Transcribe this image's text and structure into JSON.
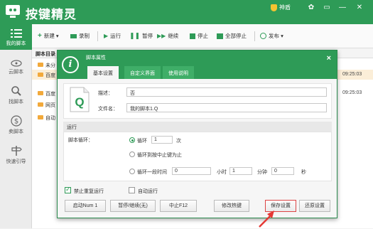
{
  "app": {
    "title": "按键精灵",
    "vip_label": "神盾"
  },
  "sidebar": {
    "items": [
      {
        "label": "我的脚本"
      },
      {
        "label": "云脚本"
      },
      {
        "label": "找脚本"
      },
      {
        "label": "卖脚本"
      },
      {
        "label": "快速引导"
      }
    ]
  },
  "toolbar": {
    "new": "新建 ▾",
    "record": "录制",
    "run": "运行",
    "pause": "暂停",
    "continue": "继续",
    "stop": "停止",
    "stop_all": "全部停止",
    "publish": "发布 ▾"
  },
  "list": {
    "header": "脚本目录",
    "rows": [
      {
        "name": "未分",
        "time": ""
      },
      {
        "name": "百度",
        "time": "09:25:03"
      },
      {
        "name": "百度",
        "time": "09:25:03"
      },
      {
        "name": "网页",
        "time": ""
      },
      {
        "name": "自动",
        "time": ""
      }
    ]
  },
  "dialog": {
    "title": "脚本属性",
    "close": "×",
    "tabs": [
      "基本设置",
      "自定义界面",
      "使用说明"
    ],
    "desc_label": "描述：",
    "desc_value": "否",
    "filename_label": "文件名：",
    "filename_value": "我的脚本1.Q",
    "section_run": "运行",
    "loop_label": "脚本循环：",
    "loop_option1": "循环",
    "loop_count": "1",
    "loop_unit": "次",
    "loop_option2": "循环到按中止键为止",
    "loop_option3": "循环一段时间",
    "time_hours": "0",
    "hours_unit": "小时",
    "time_minutes": "1",
    "minutes_unit": "分钟",
    "time_seconds": "0",
    "seconds_unit": "秒",
    "no_repeat": "禁止重复运行",
    "auto_run": "自动运行",
    "buttons": {
      "start": "启动Num 1",
      "pause": "暂停/继续(无)",
      "stop": "中止F12",
      "hotkey": "修改热键",
      "save": "保存设置",
      "restore": "还原设置"
    }
  },
  "colors": {
    "brand": "#2e9b57",
    "arrow": "#e53935"
  }
}
